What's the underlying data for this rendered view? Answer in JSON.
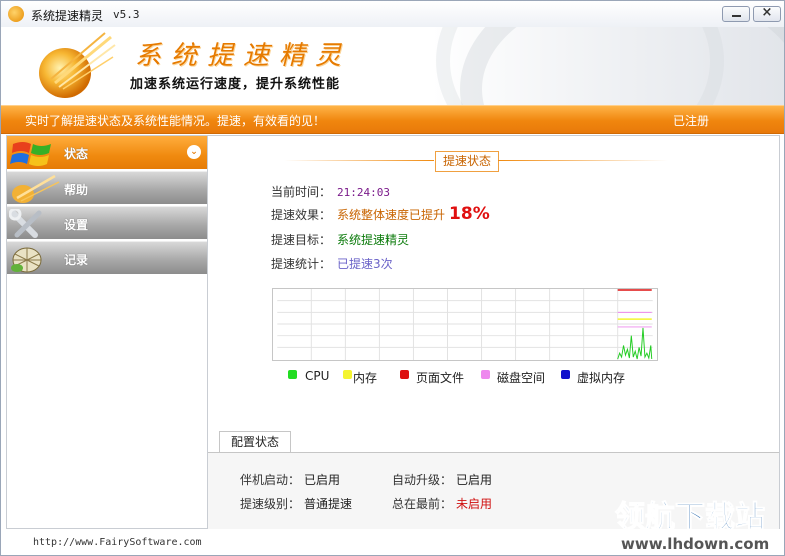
{
  "window": {
    "title": "系统提速精灵",
    "version": "v5.3",
    "minimize_glyph": "minimize-icon",
    "close_glyph": "×"
  },
  "banner": {
    "brand": "系统提速精灵",
    "slogan": "加速系统运行速度，提升系统性能"
  },
  "notice": {
    "text": "实时了解提速状态及系统性能情况。提速，有效看的见！",
    "registered": "已注册"
  },
  "sidebar": {
    "items": [
      {
        "label": "状态",
        "active": true
      },
      {
        "label": "帮助",
        "active": false
      },
      {
        "label": "设置",
        "active": false
      },
      {
        "label": "记录",
        "active": false
      }
    ]
  },
  "status": {
    "section_title": "提速状态",
    "time_label": "当前时间：",
    "time_value": "21:24:03",
    "effect_label": "提速效果：",
    "effect_value": "系统整体速度已提升",
    "effect_percent": "18%",
    "target_label": "提速目标：",
    "target_value": "系统提速精灵",
    "stats_label": "提速统计：",
    "stats_value": "已提速3次"
  },
  "legend": [
    {
      "label": "CPU",
      "color": "#22dd22"
    },
    {
      "label": "内存",
      "color": "#f4f430"
    },
    {
      "label": "页面文件",
      "color": "#dd1111"
    },
    {
      "label": "磁盘空间",
      "color": "#ee88ee"
    },
    {
      "label": "虚拟内存",
      "color": "#1111cc"
    }
  ],
  "config": {
    "tab_label": "配置状态",
    "startup_label": "伴机启动：",
    "startup_value": "已启用",
    "autoupdate_label": "自动升级：",
    "autoupdate_value": "已启用",
    "level_label": "提速级别：",
    "level_value": "普通提速",
    "ontop_label": "总在最前：",
    "ontop_value": "未启用"
  },
  "footer": {
    "url": "http://www.FairySoftware.com"
  },
  "watermark": {
    "text": "领航下载站",
    "url": "www.lhdown.com"
  }
}
